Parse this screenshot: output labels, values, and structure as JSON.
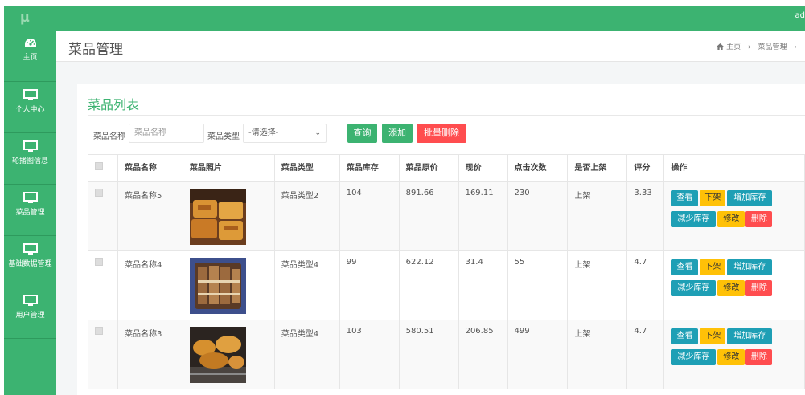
{
  "app": {
    "logo": "μ",
    "user": "ad"
  },
  "sidebar": {
    "items": [
      {
        "label": "主页",
        "icon": "dashboard-icon"
      },
      {
        "label": "个人中心",
        "icon": "monitor-icon"
      },
      {
        "label": "轮播图信息",
        "icon": "monitor-icon"
      },
      {
        "label": "菜品管理",
        "icon": "monitor-icon"
      },
      {
        "label": "基础数据管理",
        "icon": "monitor-icon"
      },
      {
        "label": "用户管理",
        "icon": "monitor-icon"
      }
    ]
  },
  "header": {
    "title": "菜品管理",
    "breadcrumb": {
      "home": "主页",
      "current": "菜品管理"
    }
  },
  "card": {
    "title": "菜品列表"
  },
  "search": {
    "name_label": "菜品名称",
    "name_placeholder": "菜品名称",
    "type_label": "菜品类型",
    "type_selected": "-请选择-",
    "query_button": "查询",
    "add_button": "添加",
    "batch_delete_button": "批量删除"
  },
  "table": {
    "headers": {
      "name": "菜品名称",
      "photo": "菜品照片",
      "type": "菜品类型",
      "stock": "菜品库存",
      "original_price": "菜品原价",
      "price": "现价",
      "clicks": "点击次数",
      "on_shelf": "是否上架",
      "score": "评分",
      "actions": "操作"
    },
    "rows": [
      {
        "name": "菜品名称5",
        "type": "菜品类型2",
        "stock": "104",
        "original_price": "891.66",
        "price": "169.11",
        "clicks": "230",
        "on_shelf": "上架",
        "score": "3.33"
      },
      {
        "name": "菜品名称4",
        "type": "菜品类型4",
        "stock": "99",
        "original_price": "622.12",
        "price": "31.4",
        "clicks": "55",
        "on_shelf": "上架",
        "score": "4.7"
      },
      {
        "name": "菜品名称3",
        "type": "菜品类型4",
        "stock": "103",
        "original_price": "580.51",
        "price": "206.85",
        "clicks": "499",
        "on_shelf": "上架",
        "score": "4.7"
      }
    ],
    "actions": {
      "view": "查看",
      "off_shelf": "下架",
      "add_stock": "增加库存",
      "reduce_stock": "减少库存",
      "edit": "修改",
      "delete": "删除"
    }
  },
  "colors": {
    "brand": "#3cb371",
    "danger": "#ff4d4f",
    "info": "#1e9fb5",
    "warning": "#ffc107"
  }
}
